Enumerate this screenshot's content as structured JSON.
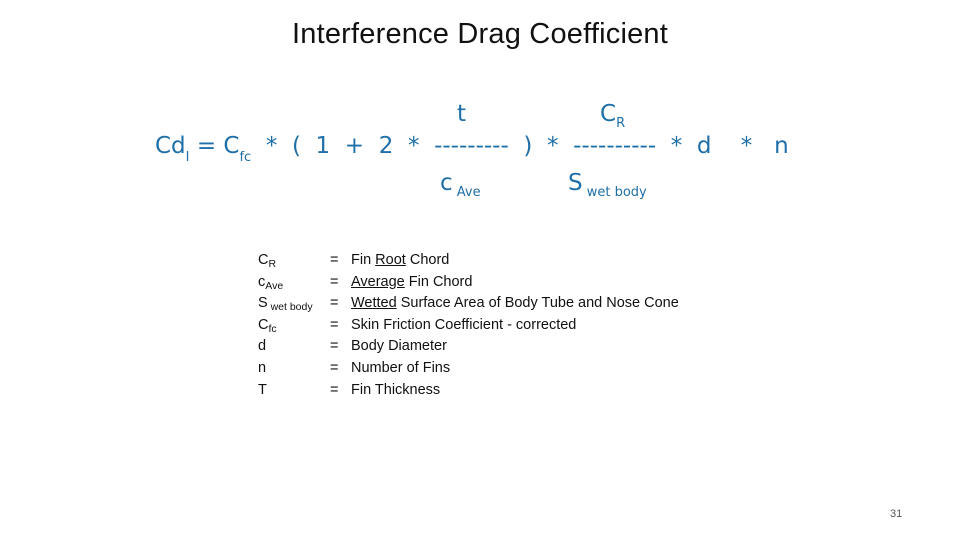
{
  "slide": {
    "title": "Interference Drag Coefficient",
    "page_number": "31",
    "formula_color": "#1F6FA8"
  },
  "formula": {
    "lhs": "Cd",
    "lhs_sub": "I",
    "eq": " = C",
    "cfc_sub": "fc",
    "part1": "  *  (  1  +  2  *  ",
    "dashes1": "---------",
    "part2": "  )  *  ",
    "dashes2": "----------",
    "part3": "  *  d    *   n",
    "numerator1": "t",
    "denominator1": "c",
    "denominator1_sub": " Ave",
    "numerator2": "C",
    "numerator2_sub": "R",
    "denominator2": "S",
    "denominator2_sub": " wet body"
  },
  "definitions": [
    {
      "symbol": "C",
      "symbol_sub": "R",
      "eq": "=",
      "pre": "Fin ",
      "underlined": "Root",
      "post": " Chord"
    },
    {
      "symbol": "c",
      "symbol_sub": "Ave",
      "eq": "=",
      "pre": "",
      "underlined": "Average",
      "post": " Fin Chord"
    },
    {
      "symbol": "S",
      "symbol_sub": " wet body",
      "eq": "=",
      "pre": "",
      "underlined": "Wetted",
      "post": " Surface Area of Body Tube and Nose Cone"
    },
    {
      "symbol": "C",
      "symbol_sub": "fc",
      "eq": "=",
      "pre": "Skin Friction Coefficient - corrected",
      "underlined": "",
      "post": ""
    },
    {
      "symbol": "d",
      "symbol_sub": "",
      "eq": "=",
      "pre": "Body Diameter",
      "underlined": "",
      "post": ""
    },
    {
      "symbol": "n",
      "symbol_sub": "",
      "eq": "=",
      "pre": "Number of Fins",
      "underlined": "",
      "post": ""
    },
    {
      "symbol": "T",
      "symbol_sub": "",
      "eq": "=",
      "pre": "Fin Thickness",
      "underlined": "",
      "post": ""
    }
  ]
}
